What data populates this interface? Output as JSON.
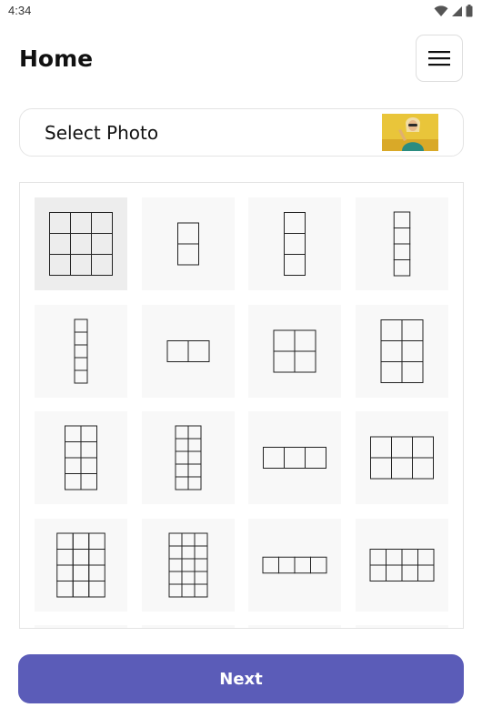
{
  "status_bar": {
    "time": "4:34",
    "icons": [
      "wifi-icon",
      "signal-icon",
      "battery-icon"
    ]
  },
  "header": {
    "title": "Home",
    "menu_icon": "hamburger-menu-icon"
  },
  "select_photo": {
    "label": "Select Photo",
    "thumbnail": "selected-photo-thumbnail"
  },
  "layouts": [
    {
      "cols": 3,
      "rows": 3,
      "selected": true
    },
    {
      "cols": 1,
      "rows": 2
    },
    {
      "cols": 1,
      "rows": 3
    },
    {
      "cols": 1,
      "rows": 4
    },
    {
      "cols": 1,
      "rows": 5
    },
    {
      "cols": 2,
      "rows": 1
    },
    {
      "cols": 2,
      "rows": 2
    },
    {
      "cols": 2,
      "rows": 3
    },
    {
      "cols": 2,
      "rows": 4
    },
    {
      "cols": 2,
      "rows": 5
    },
    {
      "cols": 3,
      "rows": 1
    },
    {
      "cols": 3,
      "rows": 2
    },
    {
      "cols": 3,
      "rows": 4
    },
    {
      "cols": 3,
      "rows": 5
    },
    {
      "cols": 4,
      "rows": 1
    },
    {
      "cols": 4,
      "rows": 2
    }
  ],
  "footer": {
    "next_label": "Next"
  },
  "colors": {
    "accent": "#5b5cb8",
    "tile_bg": "#f8f8f8",
    "tile_selected_bg": "#ededed"
  }
}
